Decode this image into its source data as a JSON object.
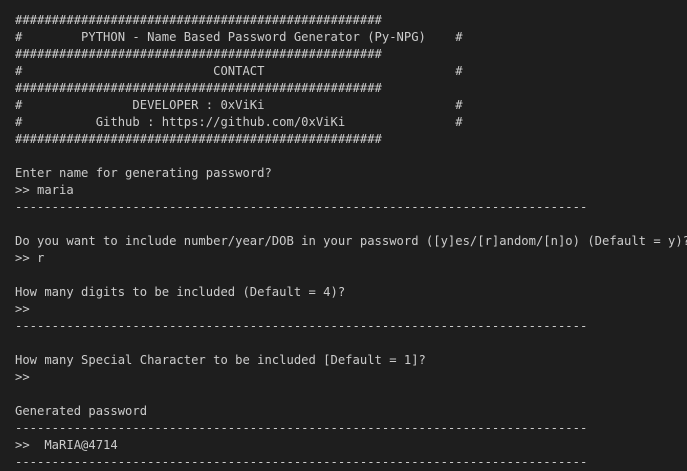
{
  "terminal": {
    "lines": [
      "##################################################",
      "#        PYTHON - Name Based Password Generator (Py-NPG)    #",
      "##################################################",
      "#                          CONTACT                          #",
      "##################################################",
      "#               DEVELOPER : 0xViKi                          #",
      "#          Github : https://github.com/0xViKi               #",
      "##################################################",
      "",
      "Enter name for generating password?",
      ">> maria",
      "------------------------------------------------------------------------------",
      "",
      "Do you want to include number/year/DOB in your password ([y]es/[r]andom/[n]o) (Default = y)?",
      ">> r",
      "",
      "How many digits to be included (Default = 4)?",
      ">>",
      "------------------------------------------------------------------------------",
      "",
      "How many Special Character to be included [Default = 1]?",
      ">>",
      "",
      "Generated password",
      "------------------------------------------------------------------------------",
      ">>  MaRIA@4714",
      "------------------------------------------------------------------------------"
    ]
  },
  "colors": {
    "background": "#1e1e1e",
    "text": "#cccccc"
  }
}
